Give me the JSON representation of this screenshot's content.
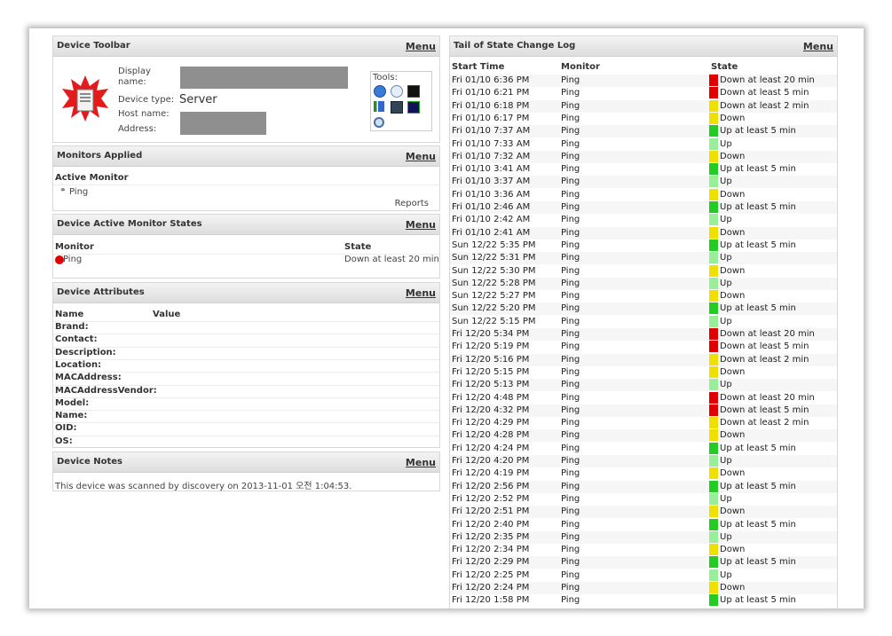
{
  "colors": {
    "red": "#e00000",
    "yellow": "#f0e000",
    "green": "#22cc22",
    "lightgreen": "#99ee99"
  },
  "toolbar": {
    "title": "Device Toolbar",
    "menu": "Menu",
    "display_name_label": "Display name:",
    "device_type_label": "Device type:",
    "device_type_value": "Server",
    "host_name_label": "Host name:",
    "address_label": "Address:",
    "tools_label": "Tools:",
    "tool_icons": [
      "globe-icon",
      "clock-icon",
      "terminal-icon",
      "chart-icon",
      "monitor-icon",
      "network-icon",
      "search-icon"
    ]
  },
  "monitors_applied": {
    "title": "Monitors Applied",
    "menu": "Menu",
    "active_label": "Active Monitor",
    "monitor": "Ping",
    "reports": "Reports"
  },
  "active_states": {
    "title": "Device Active Monitor States",
    "menu": "Menu",
    "col_monitor": "Monitor",
    "col_state": "State",
    "monitor": "Ping",
    "state": "Down at least 20 min"
  },
  "attributes": {
    "title": "Device Attributes",
    "menu": "Menu",
    "col_name": "Name",
    "col_value": "Value",
    "names": [
      "Brand:",
      "Contact:",
      "Description:",
      "Location:",
      "MACAddress:",
      "MACAddressVendor:",
      "Model:",
      "Name:",
      "OID:",
      "OS:"
    ]
  },
  "notes": {
    "title": "Device Notes",
    "menu": "Menu",
    "text": "This device was scanned by discovery on 2013-11-01 오전 1:04:53."
  },
  "log": {
    "title": "Tail of State Change Log",
    "menu": "Menu",
    "col_start": "Start Time",
    "col_monitor": "Monitor",
    "col_state": "State",
    "rows": [
      {
        "time": "Fri 01/10 6:36 PM",
        "monitor": "Ping",
        "state": "Down at least 20 min",
        "color": "red"
      },
      {
        "time": "Fri 01/10 6:21 PM",
        "monitor": "Ping",
        "state": "Down at least 5 min",
        "color": "red"
      },
      {
        "time": "Fri 01/10 6:18 PM",
        "monitor": "Ping",
        "state": "Down at least 2 min",
        "color": "yellow"
      },
      {
        "time": "Fri 01/10 6:17 PM",
        "monitor": "Ping",
        "state": "Down",
        "color": "yellow"
      },
      {
        "time": "Fri 01/10 7:37 AM",
        "monitor": "Ping",
        "state": "Up at least 5 min",
        "color": "green"
      },
      {
        "time": "Fri 01/10 7:33 AM",
        "monitor": "Ping",
        "state": "Up",
        "color": "lightgreen"
      },
      {
        "time": "Fri 01/10 7:32 AM",
        "monitor": "Ping",
        "state": "Down",
        "color": "yellow"
      },
      {
        "time": "Fri 01/10 3:41 AM",
        "monitor": "Ping",
        "state": "Up at least 5 min",
        "color": "green"
      },
      {
        "time": "Fri 01/10 3:37 AM",
        "monitor": "Ping",
        "state": "Up",
        "color": "lightgreen"
      },
      {
        "time": "Fri 01/10 3:36 AM",
        "monitor": "Ping",
        "state": "Down",
        "color": "yellow"
      },
      {
        "time": "Fri 01/10 2:46 AM",
        "monitor": "Ping",
        "state": "Up at least 5 min",
        "color": "green"
      },
      {
        "time": "Fri 01/10 2:42 AM",
        "monitor": "Ping",
        "state": "Up",
        "color": "lightgreen"
      },
      {
        "time": "Fri 01/10 2:41 AM",
        "monitor": "Ping",
        "state": "Down",
        "color": "yellow"
      },
      {
        "time": "Sun 12/22 5:35 PM",
        "monitor": "Ping",
        "state": "Up at least 5 min",
        "color": "green"
      },
      {
        "time": "Sun 12/22 5:31 PM",
        "monitor": "Ping",
        "state": "Up",
        "color": "lightgreen"
      },
      {
        "time": "Sun 12/22 5:30 PM",
        "monitor": "Ping",
        "state": "Down",
        "color": "yellow"
      },
      {
        "time": "Sun 12/22 5:28 PM",
        "monitor": "Ping",
        "state": "Up",
        "color": "lightgreen"
      },
      {
        "time": "Sun 12/22 5:27 PM",
        "monitor": "Ping",
        "state": "Down",
        "color": "yellow"
      },
      {
        "time": "Sun 12/22 5:20 PM",
        "monitor": "Ping",
        "state": "Up at least 5 min",
        "color": "green"
      },
      {
        "time": "Sun 12/22 5:15 PM",
        "monitor": "Ping",
        "state": "Up",
        "color": "lightgreen"
      },
      {
        "time": "Fri 12/20 5:34 PM",
        "monitor": "Ping",
        "state": "Down at least 20 min",
        "color": "red"
      },
      {
        "time": "Fri 12/20 5:19 PM",
        "monitor": "Ping",
        "state": "Down at least 5 min",
        "color": "red"
      },
      {
        "time": "Fri 12/20 5:16 PM",
        "monitor": "Ping",
        "state": "Down at least 2 min",
        "color": "yellow"
      },
      {
        "time": "Fri 12/20 5:15 PM",
        "monitor": "Ping",
        "state": "Down",
        "color": "yellow"
      },
      {
        "time": "Fri 12/20 5:13 PM",
        "monitor": "Ping",
        "state": "Up",
        "color": "lightgreen"
      },
      {
        "time": "Fri 12/20 4:48 PM",
        "monitor": "Ping",
        "state": "Down at least 20 min",
        "color": "red"
      },
      {
        "time": "Fri 12/20 4:32 PM",
        "monitor": "Ping",
        "state": "Down at least 5 min",
        "color": "red"
      },
      {
        "time": "Fri 12/20 4:29 PM",
        "monitor": "Ping",
        "state": "Down at least 2 min",
        "color": "yellow"
      },
      {
        "time": "Fri 12/20 4:28 PM",
        "monitor": "Ping",
        "state": "Down",
        "color": "yellow"
      },
      {
        "time": "Fri 12/20 4:24 PM",
        "monitor": "Ping",
        "state": "Up at least 5 min",
        "color": "green"
      },
      {
        "time": "Fri 12/20 4:20 PM",
        "monitor": "Ping",
        "state": "Up",
        "color": "lightgreen"
      },
      {
        "time": "Fri 12/20 4:19 PM",
        "monitor": "Ping",
        "state": "Down",
        "color": "yellow"
      },
      {
        "time": "Fri 12/20 2:56 PM",
        "monitor": "Ping",
        "state": "Up at least 5 min",
        "color": "green"
      },
      {
        "time": "Fri 12/20 2:52 PM",
        "monitor": "Ping",
        "state": "Up",
        "color": "lightgreen"
      },
      {
        "time": "Fri 12/20 2:51 PM",
        "monitor": "Ping",
        "state": "Down",
        "color": "yellow"
      },
      {
        "time": "Fri 12/20 2:40 PM",
        "monitor": "Ping",
        "state": "Up at least 5 min",
        "color": "green"
      },
      {
        "time": "Fri 12/20 2:35 PM",
        "monitor": "Ping",
        "state": "Up",
        "color": "lightgreen"
      },
      {
        "time": "Fri 12/20 2:34 PM",
        "monitor": "Ping",
        "state": "Down",
        "color": "yellow"
      },
      {
        "time": "Fri 12/20 2:29 PM",
        "monitor": "Ping",
        "state": "Up at least 5 min",
        "color": "green"
      },
      {
        "time": "Fri 12/20 2:25 PM",
        "monitor": "Ping",
        "state": "Up",
        "color": "lightgreen"
      },
      {
        "time": "Fri 12/20 2:24 PM",
        "monitor": "Ping",
        "state": "Down",
        "color": "yellow"
      },
      {
        "time": "Fri 12/20 1:58 PM",
        "monitor": "Ping",
        "state": "Up at least 5 min",
        "color": "green"
      }
    ]
  }
}
